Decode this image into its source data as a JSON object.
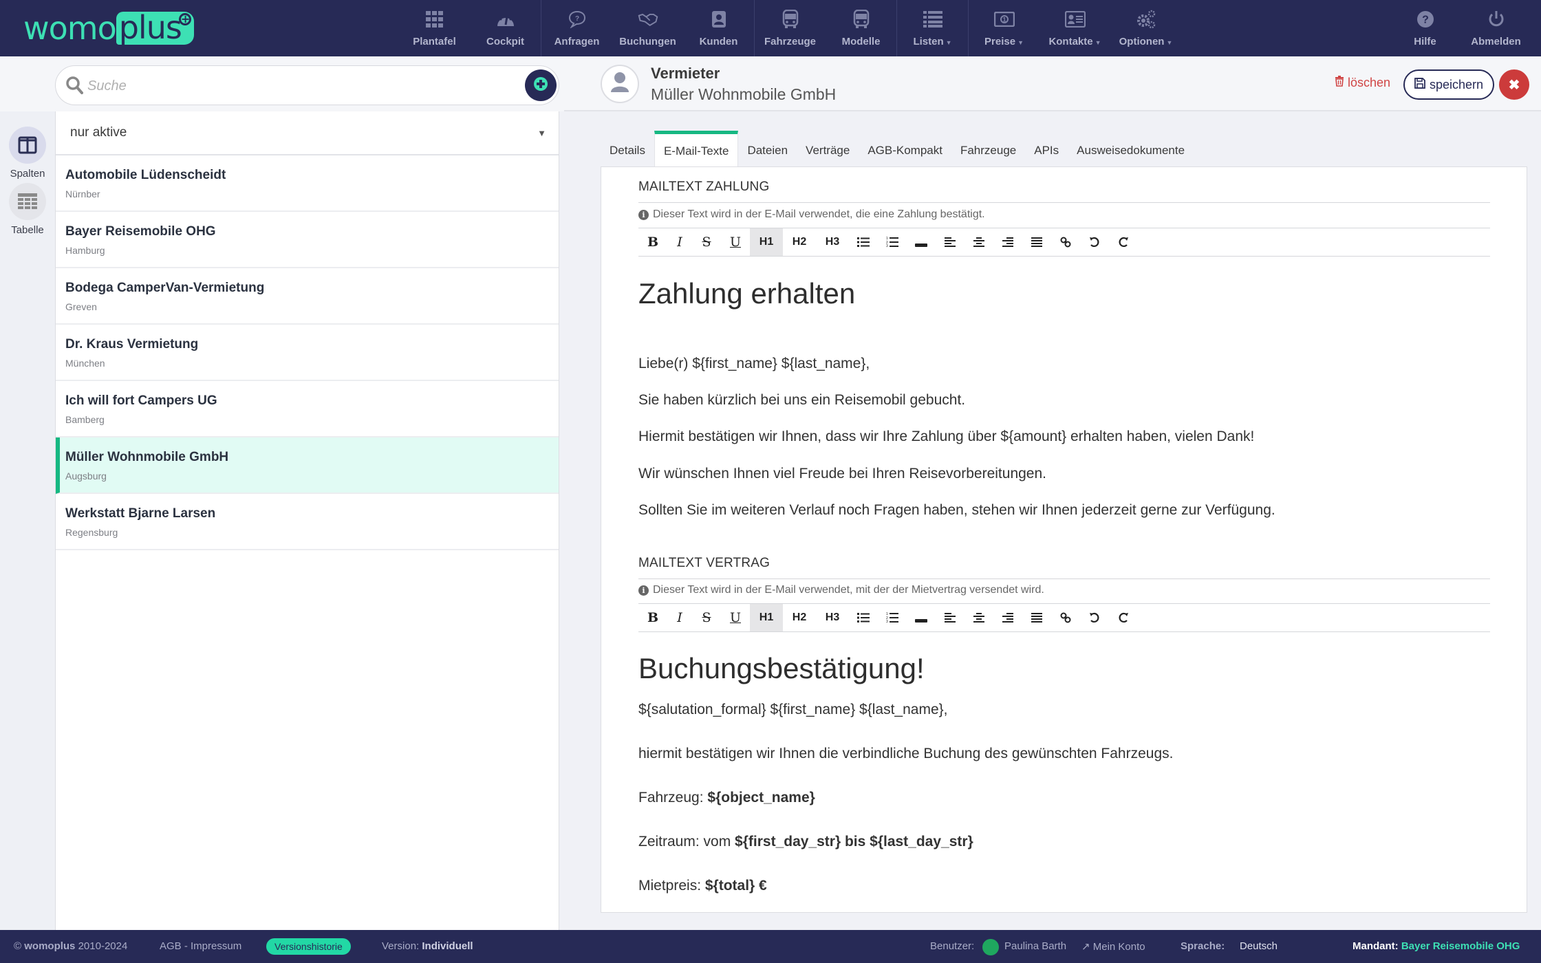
{
  "app": {
    "logo_text_a": "womo",
    "logo_text_b": "plus",
    "brand_color": "#3de0b4",
    "nav_bg": "#272a56"
  },
  "nav": {
    "groups": [
      [
        {
          "label": "Plantafel",
          "icon": "grid-icon"
        },
        {
          "label": "Cockpit",
          "icon": "dashboard-icon"
        }
      ],
      [
        {
          "label": "Anfragen",
          "icon": "question-bubble-icon"
        },
        {
          "label": "Buchungen",
          "icon": "handshake-icon"
        },
        {
          "label": "Kunden",
          "icon": "address-book-icon"
        }
      ],
      [
        {
          "label": "Fahrzeuge",
          "icon": "bus-icon"
        },
        {
          "label": "Modelle",
          "icon": "bus-icon"
        }
      ],
      [
        {
          "label": "Listen",
          "icon": "list-icon",
          "dropdown": true
        }
      ],
      [
        {
          "label": "Preise",
          "icon": "money-icon",
          "dropdown": true
        },
        {
          "label": "Kontakte",
          "icon": "contact-card-icon",
          "dropdown": true
        },
        {
          "label": "Optionen",
          "icon": "gears-icon",
          "dropdown": true
        }
      ]
    ],
    "right": [
      {
        "label": "Hilfe",
        "icon": "help-icon"
      },
      {
        "label": "Abmelden",
        "icon": "power-icon"
      }
    ]
  },
  "search": {
    "placeholder": "Suche",
    "value": ""
  },
  "rail": [
    {
      "label": "Spalten",
      "icon": "columns-icon",
      "active": true
    },
    {
      "label": "Tabelle",
      "icon": "table-icon",
      "active": false
    }
  ],
  "filter": {
    "selected": "nur aktive"
  },
  "list": [
    {
      "name": "Automobile Lüdenscheidt",
      "city": "Nürnber"
    },
    {
      "name": "Bayer Reisemobile OHG",
      "city": "Hamburg"
    },
    {
      "name": "Bodega CamperVan-Vermietung",
      "city": "Greven"
    },
    {
      "name": "Dr. Kraus Vermietung",
      "city": "München"
    },
    {
      "name": "Ich will fort Campers UG",
      "city": "Bamberg"
    },
    {
      "name": "Müller Wohnmobile GmbH",
      "city": "Augsburg",
      "selected": true
    },
    {
      "name": "Werkstatt Bjarne Larsen",
      "city": "Regensburg"
    }
  ],
  "detail": {
    "type": "Vermieter",
    "name": "Müller Wohnmobile GmbH",
    "delete_label": "löschen",
    "save_label": "speichern"
  },
  "tabs": [
    {
      "label": "Details"
    },
    {
      "label": "E-Mail-Texte",
      "active": true
    },
    {
      "label": "Dateien"
    },
    {
      "label": "Verträge"
    },
    {
      "label": "AGB-Kompakt"
    },
    {
      "label": "Fahrzeuge"
    },
    {
      "label": "APIs"
    },
    {
      "label": "Ausweisedokumente"
    }
  ],
  "toolbar": [
    "B",
    "I",
    "S",
    "U",
    "H1",
    "H2",
    "H3",
    "bullet-list",
    "numbered-list",
    "horizontal-rule",
    "align-left",
    "align-center",
    "align-right",
    "justify",
    "link",
    "undo",
    "redo"
  ],
  "sections": {
    "zahlung": {
      "title": "MAILTEXT ZAHLUNG",
      "hint": "Dieser Text wird in der E-Mail verwendet, die eine Zahlung bestätigt.",
      "heading": "Zahlung erhalten",
      "paragraphs": [
        "Liebe(r) ${first_name} ${last_name},",
        "Sie haben kürzlich bei uns ein Reisemobil gebucht.",
        "Hiermit bestätigen wir Ihnen, dass wir Ihre Zahlung über ${amount} erhalten haben, vielen Dank!",
        "Wir wünschen Ihnen viel Freude bei Ihren Reisevorbereitungen.",
        "Sollten Sie im weiteren Verlauf noch Fragen haben, stehen wir Ihnen jederzeit gerne zur Verfügung."
      ]
    },
    "vertrag": {
      "title": "MAILTEXT VERTRAG",
      "hint": "Dieser Text wird in der E-Mail verwendet, mit der der Mietvertrag versendet wird.",
      "heading": "Buchungsbestätigung!",
      "salutation": "${salutation_formal} ${first_name} ${last_name},",
      "intro": "hiermit bestätigen wir Ihnen die verbindliche Buchung des gewünschten Fahrzeugs.",
      "vehicle_label": "Fahrzeug:",
      "vehicle_value": "${object_name}",
      "period_label": "Zeitraum: vom",
      "period_value": "${first_day_str} bis ${last_day_str}",
      "price_label": "Mietpreis:",
      "price_value": "${total} €"
    }
  },
  "footer": {
    "copyright_symbol": "©",
    "brand": "womoplus",
    "years": "2010-2024",
    "agb": "AGB - Impressum",
    "version_history": "Versionshistorie",
    "version_label": "Version:",
    "version_value": "Individuell",
    "user_label": "Benutzer:",
    "user_name": "Paulina Barth",
    "account": "Mein Konto",
    "language_label": "Sprache:",
    "language_value": "Deutsch",
    "tenant_label": "Mandant:",
    "tenant_value": "Bayer Reisemobile OHG"
  }
}
